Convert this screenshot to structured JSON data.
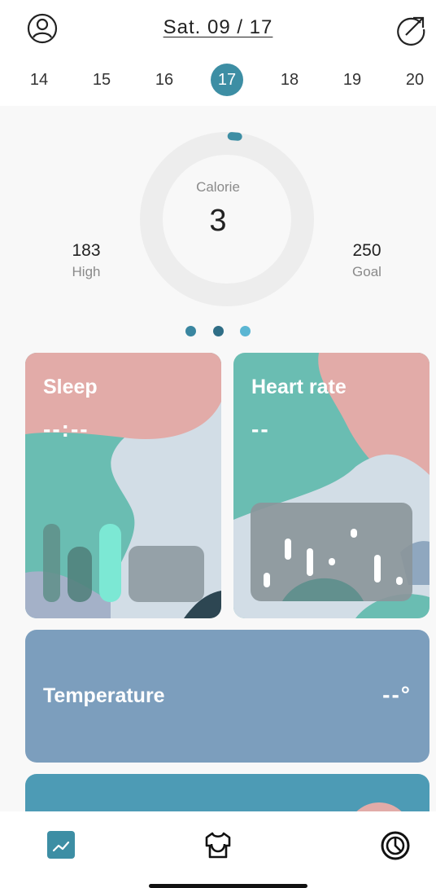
{
  "header": {
    "date_label": "Sat. 09 / 17",
    "profile_icon": "user-circle-icon",
    "export_icon": "share-arrow-icon"
  },
  "week": {
    "days": [
      "14",
      "15",
      "16",
      "17",
      "18",
      "19",
      "20"
    ],
    "selected": "17"
  },
  "summary": {
    "metric_label": "Calorie",
    "metric_value": "3",
    "progress": 0.012,
    "high_value": "183",
    "high_label": "High",
    "goal_value": "250",
    "goal_label": "Goal"
  },
  "pager": {
    "count": 3,
    "active_index": 2
  },
  "cards": {
    "sleep": {
      "title": "Sleep",
      "value": "--:--"
    },
    "heart_rate": {
      "title": "Heart rate",
      "value": "--"
    },
    "temperature": {
      "title": "Temperature",
      "value": "--°"
    }
  },
  "tabs": [
    {
      "name": "trend-chart-icon"
    },
    {
      "name": "shirt-icon"
    },
    {
      "name": "clock-icon"
    }
  ],
  "colors": {
    "accent": "#3d8ea4",
    "ring_track": "#ededed",
    "sleep_pink": "#e2aba8",
    "teal": "#6abdb2",
    "temperature_blue": "#7c9ebd"
  }
}
